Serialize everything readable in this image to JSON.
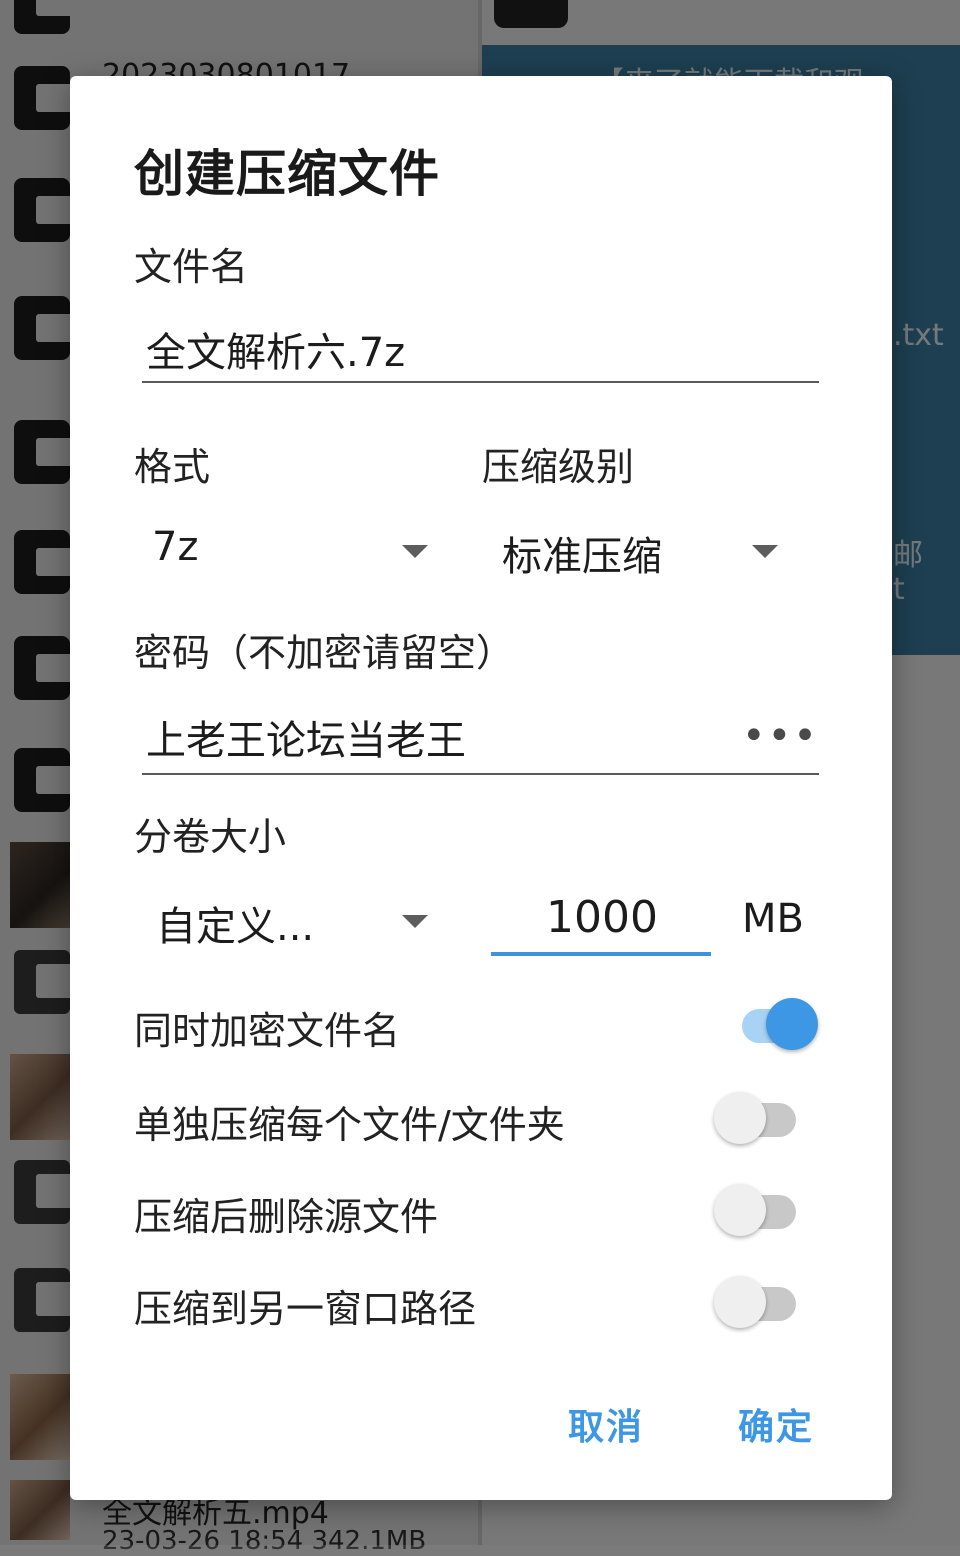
{
  "background": {
    "top_left_file_text": "2023030801017",
    "panel_text_top": "【来了就能下载和观",
    "panel_text_txt": ".txt",
    "panel_text_mail": "邮",
    "panel_text_t": "t",
    "bottom_file_name": "全文解析五.mp4",
    "bottom_file_meta": "23-03-26 18:54 342.1MB"
  },
  "dialog": {
    "title": "创建压缩文件",
    "filename_label": "文件名",
    "filename_value": "全文解析六.7z",
    "format_label": "格式",
    "format_value": "7z",
    "level_label": "压缩级别",
    "level_value": "标准压缩",
    "password_label": "密码（不加密请留空）",
    "password_value": "上老王论坛当老王",
    "password_toggle_icon": "more-dots-icon",
    "volume_label": "分卷大小",
    "volume_mode": "自定义...",
    "volume_size": "1000",
    "volume_unit": "MB",
    "options": [
      {
        "label": "同时加密文件名",
        "on": true
      },
      {
        "label": "单独压缩每个文件/文件夹",
        "on": false
      },
      {
        "label": "压缩后删除源文件",
        "on": false
      },
      {
        "label": "压缩到另一窗口路径",
        "on": false
      }
    ],
    "cancel_label": "取消",
    "ok_label": "确定"
  },
  "colors": {
    "accent": "#3d97e4",
    "panel": "#3a7fa3"
  }
}
